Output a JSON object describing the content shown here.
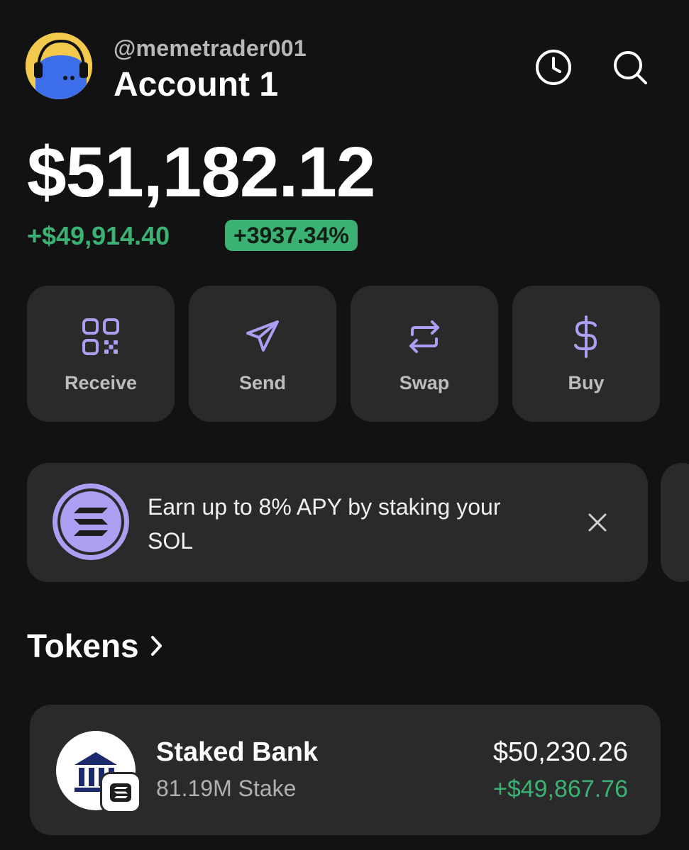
{
  "header": {
    "username": "@memetrader001",
    "account_name": "Account 1",
    "history_icon": "clock-icon",
    "search_icon": "search-icon"
  },
  "portfolio": {
    "balance": "$51,182.12",
    "change_value": "+$49,914.40",
    "change_percent": "+3937.34%",
    "positive_color": "#3bb273"
  },
  "actions": [
    {
      "label": "Receive",
      "icon": "qr-code-icon"
    },
    {
      "label": "Send",
      "icon": "send-icon"
    },
    {
      "label": "Swap",
      "icon": "swap-icon"
    },
    {
      "label": "Buy",
      "icon": "dollar-icon"
    }
  ],
  "accent_color": "#ab9ff2",
  "banner": {
    "text": "Earn up to 8% APY by staking your SOL",
    "icon": "solana-icon",
    "close_icon": "close-icon"
  },
  "tokens": {
    "title": "Tokens",
    "items": [
      {
        "name": "Staked Bank",
        "amount": "81.19M Stake",
        "value": "$50,230.26",
        "change": "+$49,867.76",
        "icon": "bank-icon",
        "badge_icon": "solana-icon"
      }
    ]
  }
}
